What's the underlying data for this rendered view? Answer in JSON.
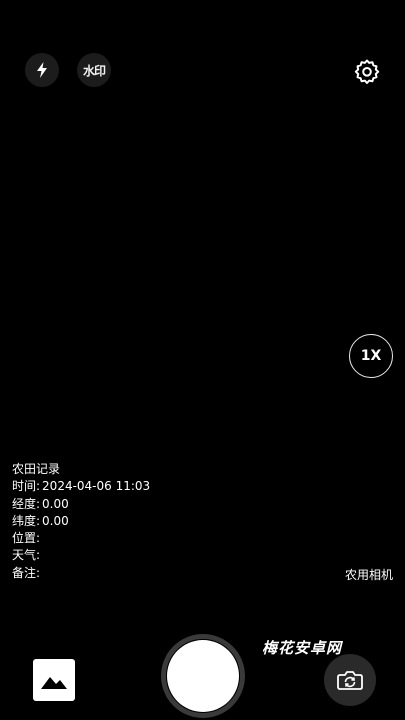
{
  "toolbar": {
    "flash_icon": "lightning-bolt-icon",
    "watermark_label": "水印",
    "settings_icon": "gear-icon"
  },
  "zoom": {
    "label": "1X"
  },
  "info": {
    "title": "农田记录",
    "lines": [
      {
        "label": "时间:",
        "value": "2024-04-06 11:03"
      },
      {
        "label": "经度:",
        "value": "0.00"
      },
      {
        "label": "纬度:",
        "value": "0.00"
      },
      {
        "label": "位置:",
        "value": ""
      },
      {
        "label": "天气:",
        "value": ""
      },
      {
        "label": "备注:",
        "value": ""
      }
    ]
  },
  "brand": "农用相机",
  "site_watermark": "梅花安卓网",
  "bottom_bar": {
    "gallery_icon": "image-gallery-icon",
    "shutter_icon": "shutter-button",
    "switch_icon": "switch-camera-icon"
  },
  "colors": {
    "background": "#000000",
    "button_bg": "#1c1c1c",
    "text": "#ffffff"
  }
}
